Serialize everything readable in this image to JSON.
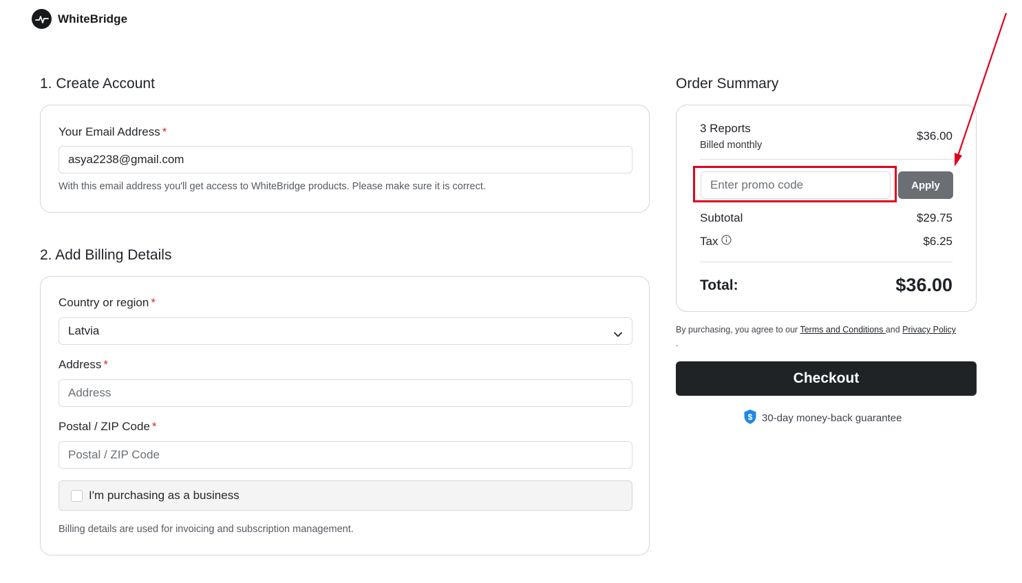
{
  "brand": {
    "name": "WhiteBridge"
  },
  "account": {
    "title": "1. Create Account",
    "email_label": "Your Email Address",
    "email_value": "asya2238@gmail.com",
    "email_help": "With this email address you'll get access to WhiteBridge products. Please make sure it is correct."
  },
  "billing": {
    "title": "2. Add Billing Details",
    "country_label": "Country or region",
    "country_value": "Latvia",
    "address_label": "Address",
    "address_placeholder": "Address",
    "zip_label": "Postal / ZIP Code",
    "zip_placeholder": "Postal / ZIP Code",
    "business_label": "I'm purchasing as a business",
    "help": "Billing details are used for invoicing and subscription management."
  },
  "summary": {
    "title": "Order Summary",
    "plan_name": "3 Reports",
    "plan_billing": "Billed monthly",
    "plan_price": "$36.00",
    "promo_placeholder": "Enter promo code",
    "apply_label": "Apply",
    "subtotal_label": "Subtotal",
    "subtotal_value": "$29.75",
    "tax_label": "Tax",
    "tax_value": "$6.25",
    "total_label": "Total:",
    "total_value": "$36.00"
  },
  "legal": {
    "prefix": "By purchasing, you agree to our ",
    "terms": "Terms and Conditions ",
    "and": "and ",
    "privacy": "Privacy Policy",
    "suffix": "."
  },
  "checkout": {
    "label": "Checkout"
  },
  "guarantee": {
    "label": "30-day money-back guarantee"
  },
  "colors": {
    "highlight": "#e0001b",
    "accent_shield": "#1e88e5",
    "checkout_bg": "#202326"
  }
}
